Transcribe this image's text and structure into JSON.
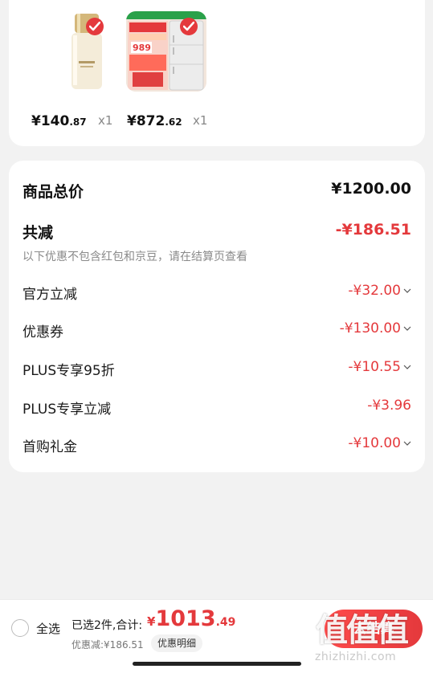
{
  "products": [
    {
      "price_symbol": "¥",
      "price_int": "140",
      "price_dec": ".87",
      "qty": "x1",
      "image": "serum-bottle"
    },
    {
      "price_symbol": "¥",
      "price_int": "872",
      "price_dec": ".62",
      "qty": "x1",
      "image": "refrigerator",
      "image_badge": "989"
    }
  ],
  "summary": {
    "total_label": "商品总价",
    "total_value": "¥1200.00",
    "reduce_label": "共减",
    "reduce_value": "-¥186.51",
    "note": "以下优惠不包含红包和京豆，请在结算页查看",
    "items": [
      {
        "label": "官方立减",
        "value": "-¥32.00",
        "expandable": true
      },
      {
        "label": "优惠券",
        "value": "-¥130.00",
        "expandable": true
      },
      {
        "label": "PLUS专享95折",
        "value": "-¥10.55",
        "expandable": true
      },
      {
        "label": "PLUS专享立减",
        "value": "-¥3.96",
        "expandable": false
      },
      {
        "label": "首购礼金",
        "value": "-¥10.00",
        "expandable": true
      }
    ]
  },
  "bottom": {
    "select_all": "全选",
    "selected_text": "已选2件,合计:",
    "total_symbol": "¥",
    "total_int": "1013",
    "total_dec": ".49",
    "discount_line": "优惠减:¥186.51",
    "detail_button": "优惠明细",
    "checkout_label": "去结算",
    "watermark": "值值值",
    "watermark_url": "zhizhizhi.com"
  },
  "colors": {
    "accent": "#e4393c",
    "background": "#f2f2f2",
    "card": "#ffffff"
  }
}
